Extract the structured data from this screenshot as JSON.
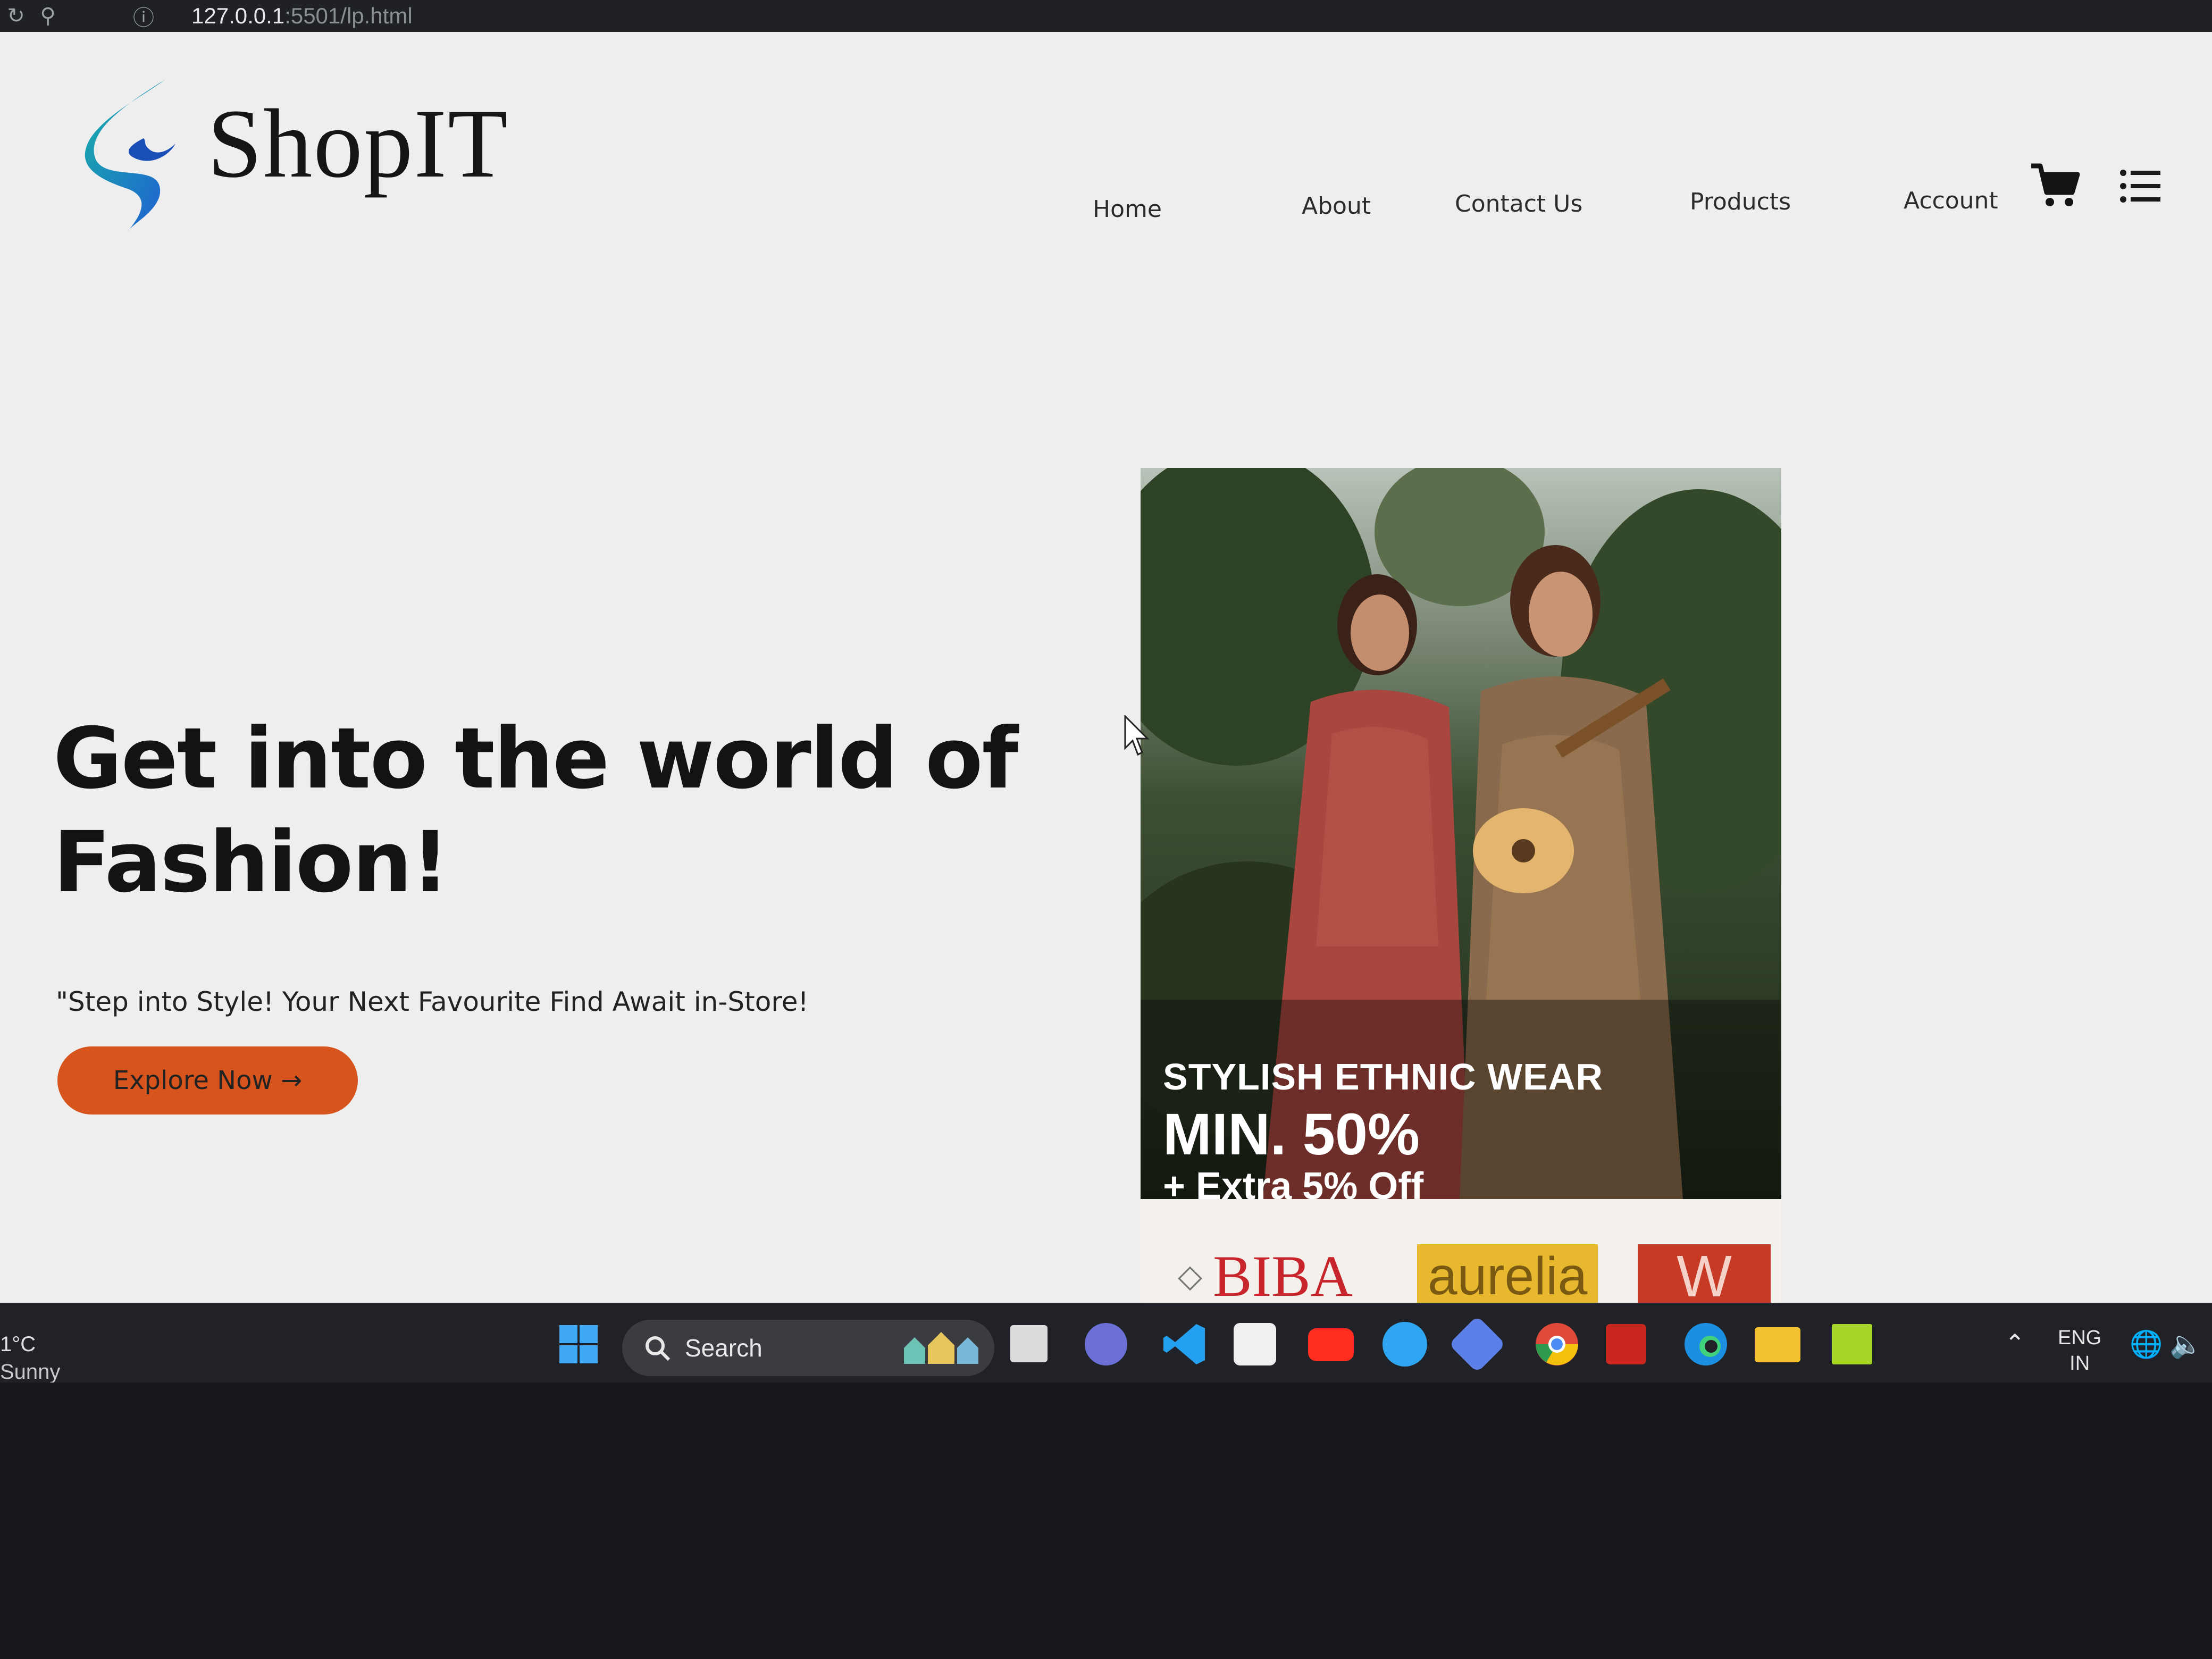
{
  "browser": {
    "url_host": "127.0.0.1",
    "url_rest": ":5501/lp.html"
  },
  "header": {
    "logo_text": "ShopIT",
    "nav": [
      "Home",
      "About",
      "Contact Us",
      "Products",
      "Account"
    ]
  },
  "hero": {
    "title_line1": "Get into the world of",
    "title_line2": "Fashion!",
    "subtitle": "\"Step into Style! Your Next Favourite Find Await in-Store!",
    "cta_label": "Explore Now →"
  },
  "promo": {
    "line1": "STYLISH ETHNIC WEAR",
    "line2": "MIN. 50%",
    "line3": "+ Extra 5% Off",
    "brands": [
      "BIBA",
      "aurelia",
      "W"
    ]
  },
  "taskbar": {
    "temperature": "1°C",
    "condition": "Sunny",
    "search_label": "Search",
    "lang_line1": "ENG",
    "lang_line2": "IN",
    "icons": [
      "windows-start-icon",
      "task-view-icon",
      "chat-icon",
      "vscode-icon",
      "store-icon",
      "youtube-icon",
      "help-icon",
      "copilot-icon",
      "chrome-icon",
      "acrobat-icon",
      "edge-icon",
      "file-explorer-icon",
      "pycharm-icon"
    ]
  },
  "colors": {
    "page_bg": "#eeeeee",
    "cta": "#d7541c",
    "logo_blue": "#1f7fd1",
    "logo_teal": "#19b3a8",
    "taskbar": "#202227"
  }
}
